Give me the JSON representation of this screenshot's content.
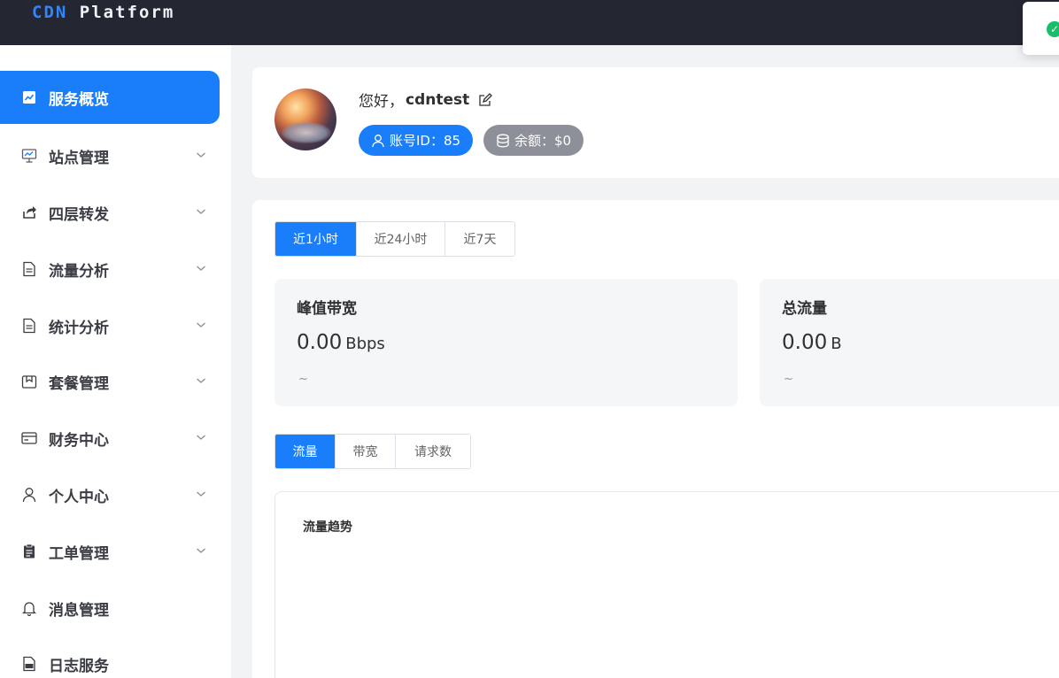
{
  "header": {
    "brand_prefix": "CDN",
    "brand_suffix": "Platform"
  },
  "sidebar": {
    "items": [
      {
        "label": "服务概览",
        "icon": "chart-icon",
        "active": true,
        "expandable": false
      },
      {
        "label": "站点管理",
        "icon": "monitor-icon",
        "active": false,
        "expandable": true
      },
      {
        "label": "四层转发",
        "icon": "share-icon",
        "active": false,
        "expandable": true
      },
      {
        "label": "流量分析",
        "icon": "document-icon",
        "active": false,
        "expandable": true
      },
      {
        "label": "统计分析",
        "icon": "document-icon",
        "active": false,
        "expandable": true
      },
      {
        "label": "套餐管理",
        "icon": "package-icon",
        "active": false,
        "expandable": true
      },
      {
        "label": "财务中心",
        "icon": "card-icon",
        "active": false,
        "expandable": true
      },
      {
        "label": "个人中心",
        "icon": "user-icon",
        "active": false,
        "expandable": true
      },
      {
        "label": "工单管理",
        "icon": "clipboard-icon",
        "active": false,
        "expandable": true
      },
      {
        "label": "消息管理",
        "icon": "bell-icon",
        "active": false,
        "expandable": false
      },
      {
        "label": "日志服务",
        "icon": "log-icon",
        "active": false,
        "expandable": false
      }
    ]
  },
  "user": {
    "greeting": "您好，",
    "username": "cdntest",
    "account_id_label": "账号ID：85",
    "balance_label": "余额：$0"
  },
  "time_range": {
    "options": [
      "近1小时",
      "近24小时",
      "近7天"
    ],
    "selected": 0
  },
  "stats": [
    {
      "title": "峰值带宽",
      "value": "0.00",
      "unit": "Bbps",
      "range": "~"
    },
    {
      "title": "总流量",
      "value": "0.00",
      "unit": "B",
      "range": "~"
    }
  ],
  "metric": {
    "options": [
      "流量",
      "带宽",
      "请求数"
    ],
    "selected": 0
  },
  "chart": {
    "title": "流量趋势"
  },
  "colors": {
    "accent": "#1a7efb",
    "topbar": "#242631",
    "success": "#19be6b",
    "balance_pill": "#8e9099"
  }
}
